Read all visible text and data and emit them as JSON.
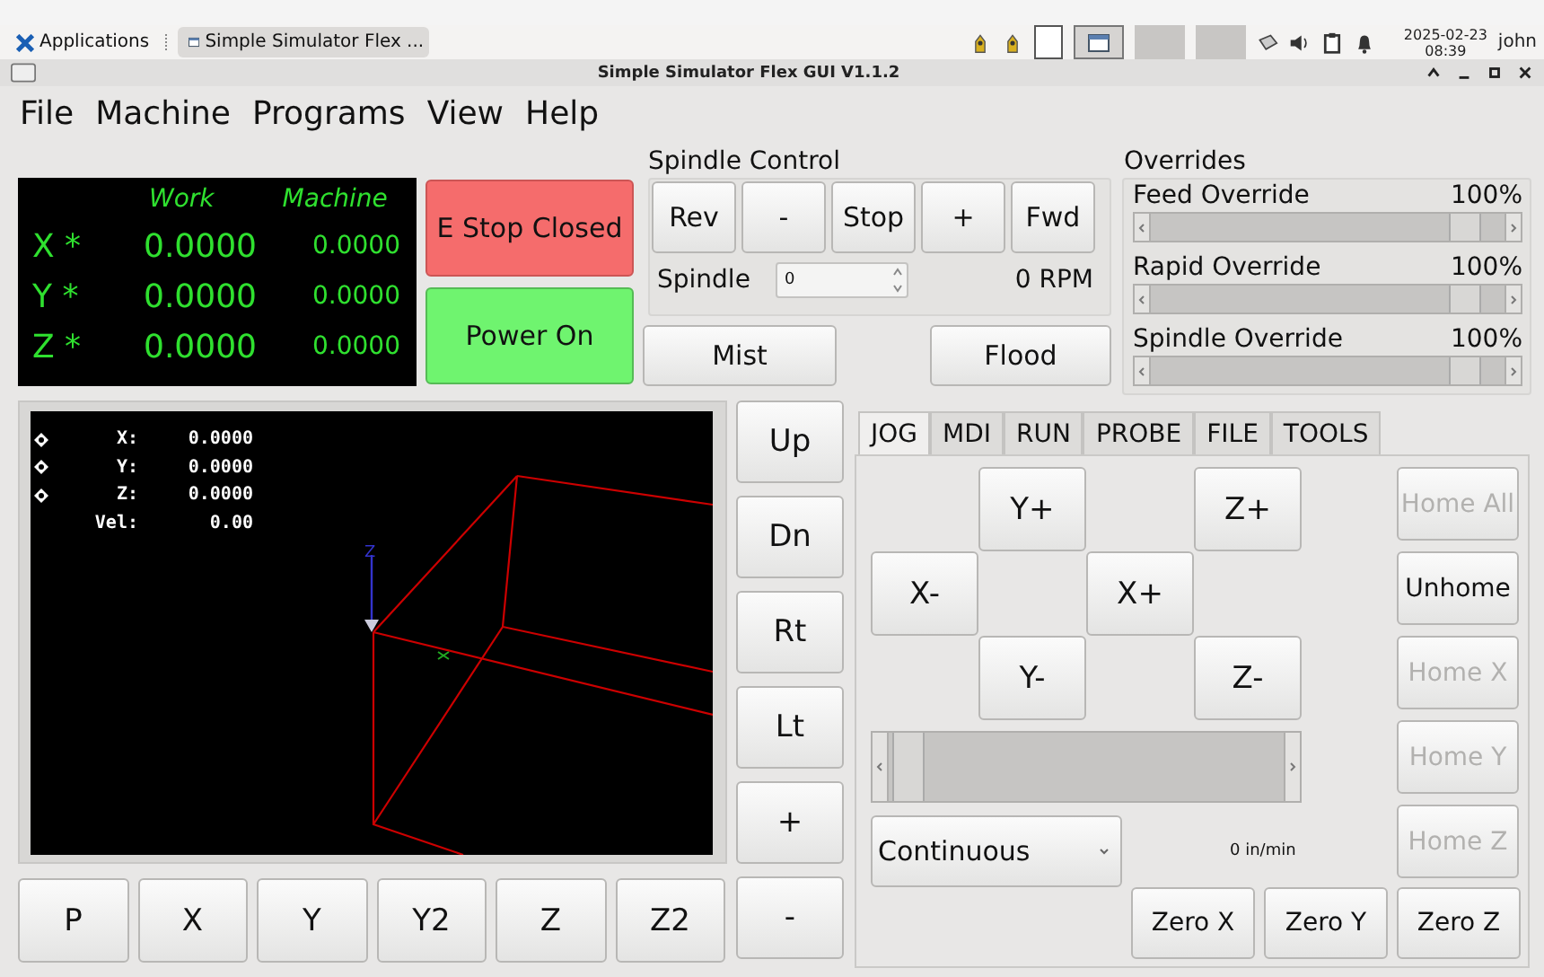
{
  "taskbar": {
    "applications": "Applications",
    "task": "Simple Simulator Flex ...",
    "date": "2025-02-23",
    "time": "08:39",
    "user": "john"
  },
  "window": {
    "title": "Simple Simulator Flex GUI V1.1.2"
  },
  "menu": [
    "File",
    "Machine",
    "Programs",
    "View",
    "Help"
  ],
  "dro": {
    "headers": [
      "Work",
      "Machine"
    ],
    "rows": [
      {
        "axis": "X *",
        "work": "0.0000",
        "machine": "0.0000"
      },
      {
        "axis": "Y *",
        "work": "0.0000",
        "machine": "0.0000"
      },
      {
        "axis": "Z *",
        "work": "0.0000",
        "machine": "0.0000"
      }
    ]
  },
  "estop": "E Stop Closed",
  "power": "Power On",
  "spindle": {
    "title": "Spindle Control",
    "buttons": [
      "Rev",
      "-",
      "Stop",
      "+",
      "Fwd"
    ],
    "label": "Spindle",
    "value": "0",
    "rpm": "0 RPM"
  },
  "coolant": [
    "Mist",
    "Flood"
  ],
  "overrides": {
    "title": "Overrides",
    "items": [
      {
        "label": "Feed Override",
        "value": "100%",
        "level": 0.93
      },
      {
        "label": "Rapid Override",
        "value": "100%",
        "level": 0.93
      },
      {
        "label": "Spindle Override",
        "value": "100%",
        "level": 0.93
      }
    ]
  },
  "preview": {
    "readouts": [
      {
        "label": "X:",
        "value": "0.0000",
        "marker": true
      },
      {
        "label": "Y:",
        "value": "0.0000",
        "marker": true
      },
      {
        "label": "Z:",
        "value": "0.0000",
        "marker": true
      },
      {
        "label": "Vel:",
        "value": "0.00",
        "marker": false
      }
    ],
    "axis_label": "Z"
  },
  "preview_buttons": [
    "P",
    "X",
    "Y",
    "Y2",
    "Z",
    "Z2"
  ],
  "view_buttons": [
    "Up",
    "Dn",
    "Rt",
    "Lt",
    "+",
    "-"
  ],
  "tabs": [
    {
      "label": "JOG",
      "selected": true
    },
    {
      "label": "MDI",
      "selected": false
    },
    {
      "label": "RUN",
      "selected": false
    },
    {
      "label": "PROBE",
      "selected": false
    },
    {
      "label": "FILE",
      "selected": false
    },
    {
      "label": "TOOLS",
      "selected": false
    }
  ],
  "jog": {
    "buttons": [
      "Y+",
      "Z+",
      "X-",
      "X+",
      "Y-",
      "Z-"
    ],
    "speed": {
      "level": 0.01
    },
    "mode": "Continuous",
    "rate": "0 in/min",
    "home": [
      {
        "label": "Home All",
        "disabled": true
      },
      {
        "label": "Unhome",
        "disabled": false
      },
      {
        "label": "Home X",
        "disabled": true
      },
      {
        "label": "Home Y",
        "disabled": true
      },
      {
        "label": "Home Z",
        "disabled": true
      }
    ],
    "zero": [
      "Zero X",
      "Zero Y",
      "Zero Z"
    ]
  }
}
